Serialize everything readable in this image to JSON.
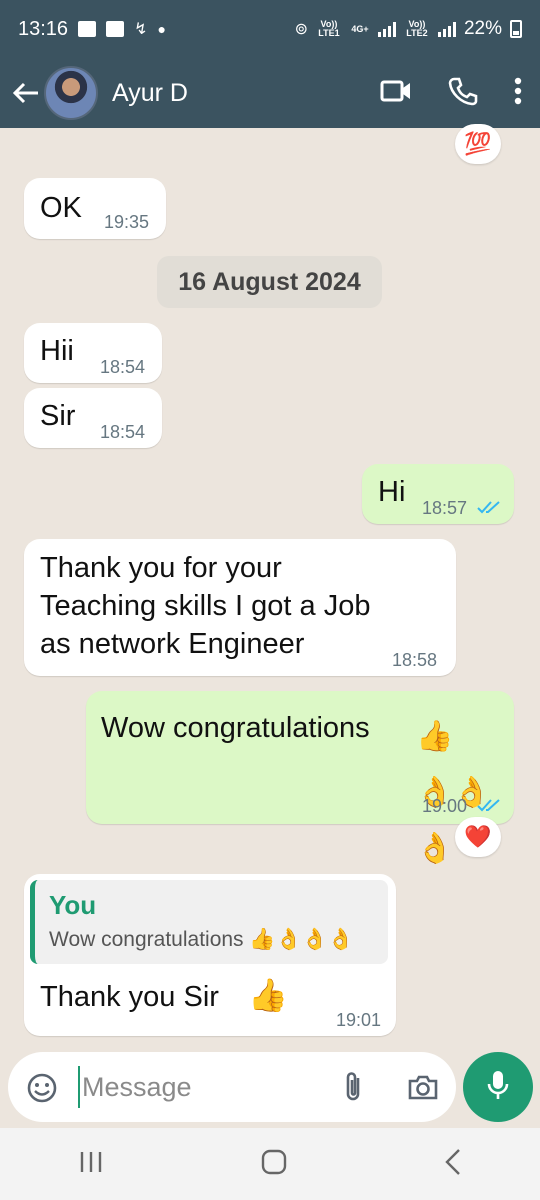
{
  "status_bar": {
    "time": "13:16",
    "net_labels": [
      "Vo)) LTE1",
      "4G+",
      "Vo)) LTE2"
    ],
    "battery": "22%"
  },
  "header": {
    "contact_name": "Ayur D",
    "icons": [
      "back-arrow-icon",
      "video-call-icon",
      "voice-call-icon",
      "more-icon"
    ]
  },
  "messages": {
    "m1": {
      "text": "OK",
      "time": "19:35",
      "direction": "in"
    },
    "date_divider": "16 August 2024",
    "m2": {
      "text": "Hii",
      "time": "18:54",
      "direction": "in"
    },
    "m3": {
      "text": "Sir",
      "time": "18:54",
      "direction": "in"
    },
    "m4": {
      "text": "Hi",
      "time": "18:57",
      "direction": "out",
      "status": "read"
    },
    "m5": {
      "line1": "Thank you for your",
      "line2": "Teaching skills I got a Job",
      "line3": "as network Engineer",
      "time": "18:58",
      "direction": "in"
    },
    "m6": {
      "text": "Wow congratulations",
      "emoji": "👍 👌👌👌",
      "time": "19:00",
      "direction": "out",
      "status": "read",
      "reaction": "❤️"
    },
    "m7": {
      "quote_author": "You",
      "quote_text": "Wow congratulations 👍👌👌👌",
      "text": "Thank you Sir",
      "emoji": "👍",
      "time": "19:01",
      "direction": "in"
    },
    "top_reaction": "💯"
  },
  "composer": {
    "placeholder": "Message"
  },
  "colors": {
    "header": "#3b5360",
    "chat_bg": "#ece5dd",
    "outgoing_bubble": "#dcf8c6",
    "accent": "#1f9b72",
    "read_tick": "#34b7f1"
  }
}
